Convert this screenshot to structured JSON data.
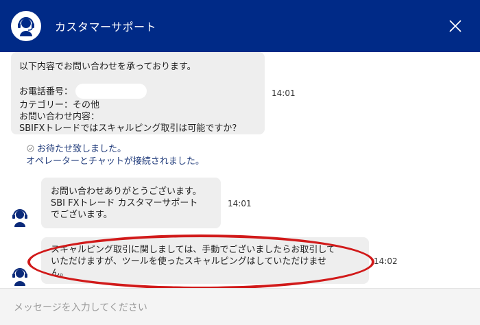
{
  "header": {
    "title": "カスタマーサポート",
    "avatar_icon": "headset-agent-icon",
    "close_icon": "close-icon",
    "background_color": "#002a87"
  },
  "messages": [
    {
      "sender": "user",
      "lines": [
        "以下内容でお問い合わせを承っております。",
        "",
        "お電話番号：",
        "カテゴリー：その他",
        "お問い合わせ内容：",
        "SBIFXトレードではスキャルピング取引は可能ですか？"
      ],
      "time": "14:01"
    },
    {
      "sender": "system",
      "lines": [
        "お待たせ致しました。",
        "オペレーターとチャットが接続されました。"
      ]
    },
    {
      "sender": "agent",
      "lines": [
        "お問い合わせありがとうございます。",
        "SBI FXトレード カスタマーサポート",
        "でございます。"
      ],
      "time": "14:01"
    },
    {
      "sender": "agent",
      "lines": [
        "スキャルピング取引に関しましては、手動でございましたらお取引して",
        "いただけますが、ツールを使ったスキャルピングはしていただけませ",
        "ん。"
      ],
      "time": "14:02",
      "highlighted": true,
      "highlight_color": "#d11a1a"
    }
  ],
  "composer": {
    "placeholder": "メッセージを入力してください"
  }
}
